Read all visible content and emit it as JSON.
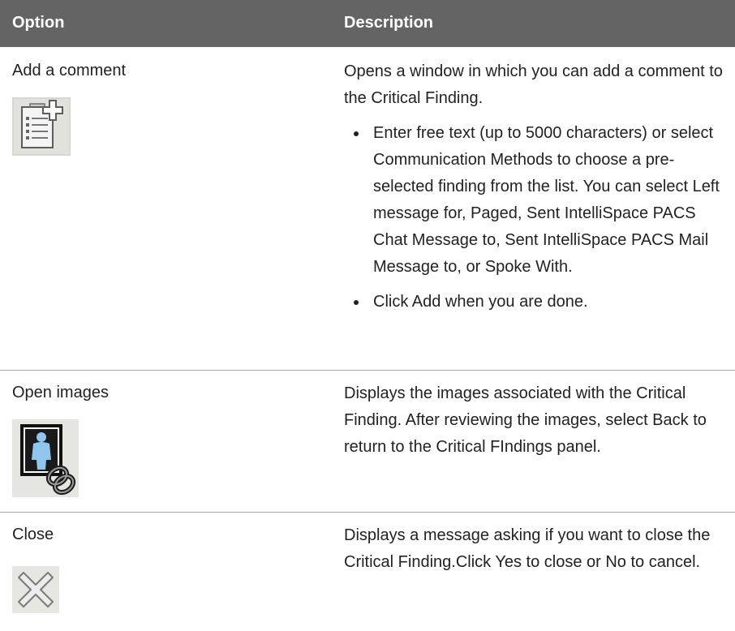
{
  "header": {
    "option": "Option",
    "description": "Description"
  },
  "rows": [
    {
      "option": "Add a comment",
      "icon": "add-comment-icon",
      "description": "Opens a window in which you can add a comment to the Critical Finding.",
      "bullets": [
        "Enter free text (up to 5000 characters) or select Communication Methods to choose a pre-selected finding from the list. You can select Left message for, Paged, Sent IntelliSpace PACS Chat Message to, Sent IntelliSpace PACS Mail Message to, or Spoke With.",
        "Click Add when you are done."
      ]
    },
    {
      "option": "Open images",
      "icon": "open-images-icon",
      "description": "Displays the images associated with the Critical Finding. After reviewing the images, select Back to return to the Critical FIndings panel."
    },
    {
      "option": "Close",
      "icon": "close-icon",
      "description": "Displays a message asking if you want to close the Critical Finding.Click Yes to close or No to cancel."
    }
  ]
}
